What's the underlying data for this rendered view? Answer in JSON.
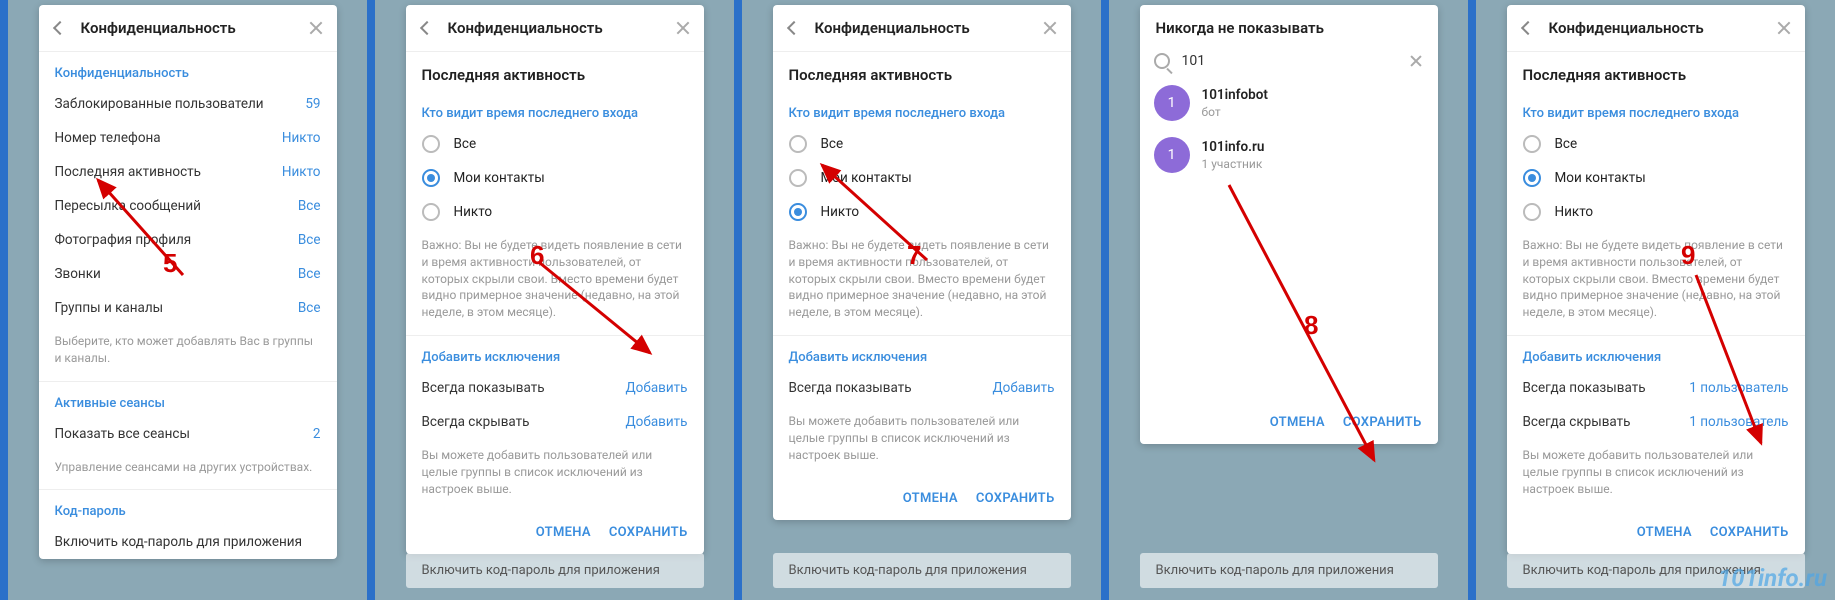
{
  "steps": [
    "5",
    "6",
    "7",
    "8",
    "9"
  ],
  "privacy": {
    "title": "Конфиденциальность",
    "section": "Конфиденциальность",
    "items": [
      {
        "label": "Заблокированные пользователи",
        "value": "59"
      },
      {
        "label": "Номер телефона",
        "value": "Никто"
      },
      {
        "label": "Последняя активность",
        "value": "Никто"
      },
      {
        "label": "Пересылка сообщений",
        "value": "Все"
      },
      {
        "label": "Фотография профиля",
        "value": "Все"
      },
      {
        "label": "Звонки",
        "value": "Все"
      },
      {
        "label": "Группы и каналы",
        "value": "Все"
      }
    ],
    "note1": "Выберите, кто может добавлять Вас в группы и каналы.",
    "sessions_title": "Активные сеансы",
    "sessions_label": "Показать все сеансы",
    "sessions_value": "2",
    "note2": "Управление сеансами на других устройствах.",
    "passcode_title": "Код-пароль",
    "passcode_label": "Включить код-пароль для приложения"
  },
  "lastseen": {
    "title": "Последняя активность",
    "who": "Кто видит время последнего входа",
    "opts": [
      "Все",
      "Мои контакты",
      "Никто"
    ],
    "note": "Важно: Вы не будете видеть появление в сети и время активности пользователей, от которых скрыли свои. Вместо времени будет видно примерное значение (недавно, на этой неделе, в этом месяце).",
    "exc_title": "Добавить исключения",
    "always_show": "Всегда показывать",
    "always_hide": "Всегда скрывать",
    "add": "Добавить",
    "one_user": "1 пользователь",
    "exc_note": "Вы можете добавить пользователей или целые группы в список исключений из настроек выше.",
    "cancel": "ОТМЕНА",
    "save": "СОХРАНИТЬ"
  },
  "never": {
    "title": "Никогда не показывать",
    "query": "101",
    "results": [
      {
        "avatar": "1",
        "name": "101infobot",
        "sub": "бот"
      },
      {
        "avatar": "1",
        "name": "101info.ru",
        "sub": "1 участник"
      }
    ]
  },
  "behind_label": "Включить код-пароль для приложения",
  "watermark": "101info.ru"
}
